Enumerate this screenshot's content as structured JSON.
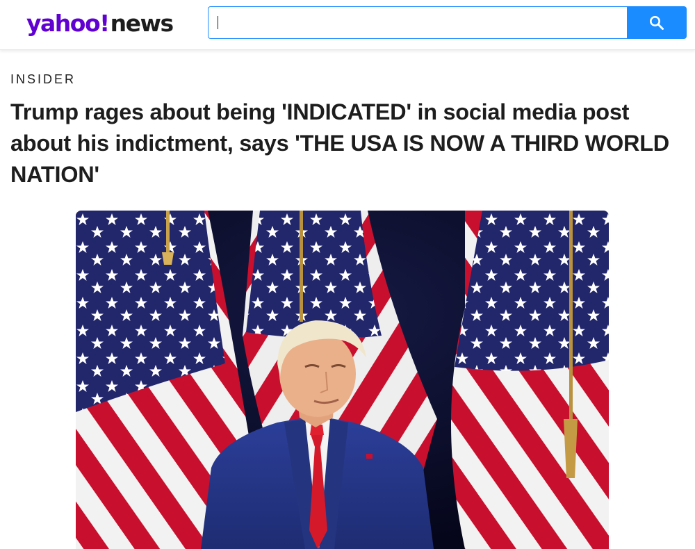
{
  "header": {
    "logo": {
      "brand": "yahoo!",
      "product": "news"
    },
    "search": {
      "value": "",
      "placeholder": ""
    },
    "search_button_icon": "search-icon"
  },
  "article": {
    "publisher": "INSIDER",
    "headline": "Trump rages about being 'INDICATED' in social media post about his indictment, says 'THE USA IS NOW A THIRD WORLD NATION'",
    "hero_image": {
      "subject": "photo-of-man-in-blue-suit-and-red-tie-in-front-of-american-flags"
    }
  },
  "colors": {
    "brand_purple": "#6001d2",
    "search_blue": "#1a8cff",
    "text": "#1d1d1d",
    "flag_red": "#c8102e",
    "flag_blue": "#22266b"
  }
}
